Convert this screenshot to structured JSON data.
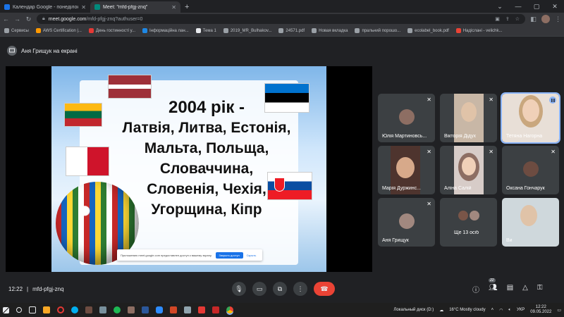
{
  "browser": {
    "tabs": [
      {
        "title": "Календар Google - понеділок, 9 т",
        "icon": "calendar-icon",
        "color": "#1a73e8",
        "active": false
      },
      {
        "title": "Meet: \"mfd-pfgj-znq\"",
        "icon": "meet-icon",
        "color": "#00897b",
        "active": true
      }
    ],
    "new_tab": "+",
    "address": {
      "host": "meet.google.com",
      "path": "/mfd-pfgj-znq?authuser=0"
    },
    "bookmarks": [
      {
        "label": "Сервисы",
        "color": "#9aa0a6"
      },
      {
        "label": "AWS Certification |...",
        "color": "#ff9900"
      },
      {
        "label": "День гостинності у...",
        "color": "#e53935"
      },
      {
        "label": "Інформаційна лан...",
        "color": "#1e88e5"
      },
      {
        "label": "Тема 1",
        "color": "#e8eaed"
      },
      {
        "label": "2019_MR_Bulhakov...",
        "color": "#9aa0a6"
      },
      {
        "label": "24571.pdf",
        "color": "#9aa0a6"
      },
      {
        "label": "Новая вкладка",
        "color": "#9aa0a6"
      },
      {
        "label": "пральний порошо...",
        "color": "#9aa0a6"
      },
      {
        "label": "ecolabel_book.pdf",
        "color": "#9aa0a6"
      },
      {
        "label": "Надіслані - velichk...",
        "color": "#ea4335"
      }
    ]
  },
  "meet": {
    "presenter_label": "Аня Грищук на екрані",
    "slide": {
      "lines": [
        "2004 рік -",
        "Латвія, Литва, Естонія,",
        "Мальта, Польща,",
        "Словаччина,",
        "Словенія, Чехія,",
        "Угорщина, Кіпр"
      ],
      "permission_text": "Приложению meet.google.com предоставлен доступ к вашему экрану.",
      "permission_button": "Закрыть доступ",
      "permission_hide": "Скрыть"
    },
    "participants": [
      {
        "name": "Юлія Мартиновсь...",
        "muted": true,
        "type": "avatar",
        "color": "#8d6e63"
      },
      {
        "name": "Вікторія Дідух",
        "muted": true,
        "type": "video",
        "color": "#a1887f"
      },
      {
        "name": "Тетяна Нагорна",
        "muted": false,
        "type": "video",
        "color": "#d7ccc8",
        "speaking": true
      },
      {
        "name": "Марія Дуржинс...",
        "muted": true,
        "type": "video",
        "color": "#8d6e63"
      },
      {
        "name": "Аліна Салій",
        "muted": true,
        "type": "video",
        "color": "#bcaaa4"
      },
      {
        "name": "Оксана Гончарук",
        "muted": true,
        "type": "avatar",
        "color": "#6d4c41"
      },
      {
        "name": "Аня Грищук",
        "muted": true,
        "type": "avatar",
        "color": "#a1887f"
      },
      {
        "name": "Ще 13 осіб",
        "muted": false,
        "type": "more",
        "color": "#795548"
      },
      {
        "name": "Ви",
        "muted": false,
        "type": "video",
        "color": "#90a4ae"
      }
    ],
    "bottom": {
      "time": "12:22",
      "separator": "|",
      "code": "mfd-pfgj-znq",
      "participants_count": "22"
    }
  },
  "taskbar": {
    "drive_label": "Локальный диск (D:)",
    "weather": "16°C  Mostly cloudy",
    "lang": "УКР",
    "time": "12:22",
    "date": "09.05.2022"
  }
}
